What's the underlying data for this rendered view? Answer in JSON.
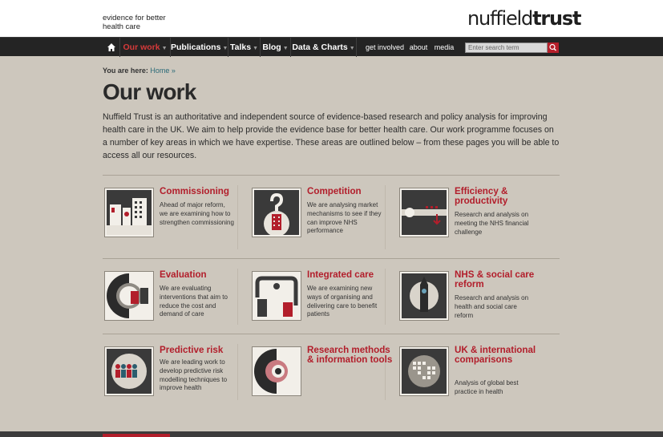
{
  "header": {
    "tagline": "evidence for better health care",
    "logo_left": "nuffield",
    "logo_right": "trust"
  },
  "nav": {
    "items": [
      {
        "label": "Our work",
        "active": true
      },
      {
        "label": "Publications"
      },
      {
        "label": "Talks"
      },
      {
        "label": "Blog"
      },
      {
        "label": "Data & Charts"
      }
    ],
    "small_items": [
      "get involved",
      "about",
      "media"
    ],
    "search_placeholder": "Enter search term"
  },
  "breadcrumb": {
    "prefix": "You are here:",
    "home": "Home »"
  },
  "page": {
    "title": "Our work",
    "intro": "Nuffield Trust is an authoritative and independent source of evidence-based research and policy analysis for improving health care in the UK. We aim to help provide the evidence base for better health care. Our work programme focuses on a number of key areas in which we have expertise. These areas are outlined below – from these pages you will be able to access all our resources."
  },
  "cards": [
    {
      "title": "Commissioning",
      "desc": "Ahead of major reform, we are examining how to strengthen commissioning",
      "icon": "buildings-icon"
    },
    {
      "title": "Competition",
      "desc": "We are analysing market mechanisms to see if they can improve NHS performance",
      "icon": "question-icon"
    },
    {
      "title": "Efficiency & productivity",
      "desc": "Research and analysis on meeting the NHS financial challenge",
      "icon": "efficiency-icon"
    },
    {
      "title": "Evaluation",
      "desc": "We are evaluating interventions that aim to reduce the cost and demand of care",
      "icon": "magnifier-icon"
    },
    {
      "title": "Integrated care",
      "desc": "We are examining new ways of organising and delivering care to benefit patients",
      "icon": "integrated-icon"
    },
    {
      "title": "NHS & social care reform",
      "desc": "Research and analysis on health and social care reform",
      "icon": "big-ben-icon"
    },
    {
      "title": "Predictive risk",
      "desc": "We are leading work to develop predictive risk modelling techniques to improve health",
      "icon": "people-icon"
    },
    {
      "title": "Research methods & information tools",
      "desc": "",
      "icon": "research-icon"
    },
    {
      "title": "UK & international comparisons",
      "desc": "Analysis of global best practice in health",
      "icon": "globe-icon"
    }
  ]
}
